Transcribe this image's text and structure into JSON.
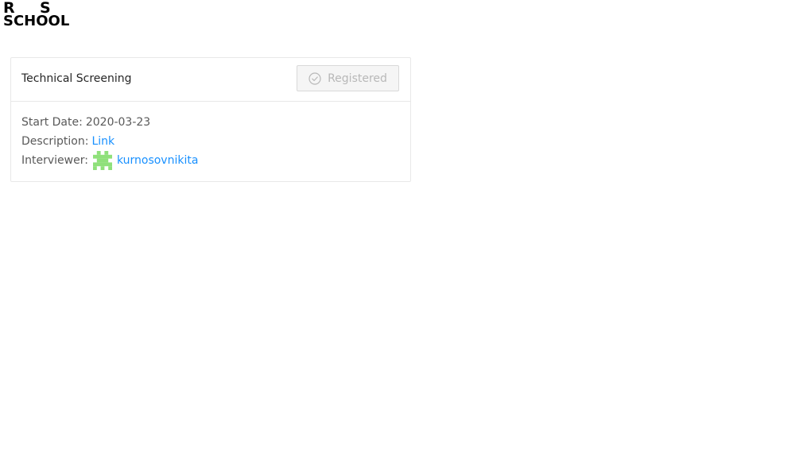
{
  "logo": {
    "line1_left": "R",
    "line1_right": "S",
    "line2": "SCHOOL"
  },
  "card": {
    "title": "Technical Screening",
    "register_button": "Registered",
    "start_date_label": "Start Date:",
    "start_date_value": "2020-03-23",
    "description_label": "Description:",
    "description_link": "Link",
    "interviewer_label": "Interviewer:",
    "interviewer_name": "kurnosovnikita"
  },
  "colors": {
    "link": "#1890ff",
    "avatar": "#8fe07a"
  },
  "icons": {
    "register_button": "check-circle-icon",
    "interviewer_avatar": "identicon-avatar"
  }
}
